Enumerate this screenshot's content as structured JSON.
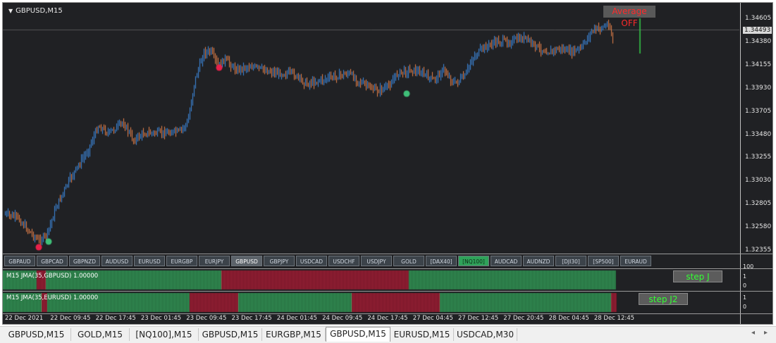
{
  "chart": {
    "symbol_title": "GBPUSD,M15",
    "average_box": "Average OFF",
    "current_price": "1.34493",
    "price_ticks": [
      "1.34605",
      "1.34380",
      "1.34155",
      "1.33930",
      "1.33705",
      "1.33480",
      "1.33255",
      "1.33030",
      "1.32805",
      "1.32580",
      "1.32355"
    ],
    "colors": {
      "bull": "#3d8be0",
      "bear": "#e8834a",
      "bg": "#202124",
      "dot_red": "#e8204a",
      "dot_green": "#3fbf78"
    }
  },
  "symbol_buttons": [
    {
      "label": "GBPAUD",
      "state": "normal"
    },
    {
      "label": "GBPCAD",
      "state": "normal"
    },
    {
      "label": "GBPNZD",
      "state": "normal"
    },
    {
      "label": "AUDUSD",
      "state": "normal"
    },
    {
      "label": "EURUSD",
      "state": "normal"
    },
    {
      "label": "EURGBP",
      "state": "normal"
    },
    {
      "label": "EURJPY",
      "state": "normal"
    },
    {
      "label": "GBPUSD",
      "state": "active"
    },
    {
      "label": "GBPJPY",
      "state": "normal"
    },
    {
      "label": "USDCAD",
      "state": "normal"
    },
    {
      "label": "USDCHF",
      "state": "normal"
    },
    {
      "label": "USDJPY",
      "state": "normal"
    },
    {
      "label": "GOLD",
      "state": "normal"
    },
    {
      "label": "[DAX40]",
      "state": "normal"
    },
    {
      "label": "[NQ100]",
      "state": "green"
    },
    {
      "label": "AUDCAD",
      "state": "normal"
    },
    {
      "label": "AUDNZD",
      "state": "normal"
    },
    {
      "label": "[DJI30]",
      "state": "normal"
    },
    {
      "label": "[SP500]",
      "state": "normal"
    },
    {
      "label": "EURAUD",
      "state": "normal"
    }
  ],
  "indicator1": {
    "label": "M15 JMA(35,GBPUSD) 1.00000",
    "step_button": "step J",
    "scale_top": "1",
    "scale_bottom": "0",
    "scale_header": "100",
    "segments": [
      {
        "color": "green",
        "from": 0.0,
        "to": 0.046
      },
      {
        "color": "red",
        "from": 0.046,
        "to": 0.059
      },
      {
        "color": "green",
        "from": 0.059,
        "to": 0.297
      },
      {
        "color": "red",
        "from": 0.297,
        "to": 0.552
      },
      {
        "color": "green",
        "from": 0.552,
        "to": 0.832
      }
    ]
  },
  "indicator2": {
    "label": "M15 JMA(35,EURUSD) 1.00000",
    "step_button": "step J2",
    "scale_top": "1",
    "scale_bottom": "0",
    "segments": [
      {
        "color": "green",
        "from": 0.0,
        "to": 0.053
      },
      {
        "color": "red",
        "from": 0.053,
        "to": 0.061
      },
      {
        "color": "green",
        "from": 0.061,
        "to": 0.254
      },
      {
        "color": "red",
        "from": 0.254,
        "to": 0.32
      },
      {
        "color": "green",
        "from": 0.32,
        "to": 0.474
      },
      {
        "color": "red",
        "from": 0.474,
        "to": 0.594
      },
      {
        "color": "green",
        "from": 0.594,
        "to": 0.826
      },
      {
        "color": "red",
        "from": 0.826,
        "to": 0.832
      }
    ]
  },
  "time_ticks": [
    "22 Dec 2021",
    "22 Dec 09:45",
    "22 Dec 17:45",
    "23 Dec 01:45",
    "23 Dec 09:45",
    "23 Dec 17:45",
    "24 Dec 01:45",
    "24 Dec 09:45",
    "24 Dec 17:45",
    "27 Dec 04:45",
    "27 Dec 12:45",
    "27 Dec 20:45",
    "28 Dec 04:45",
    "28 Dec 12:45"
  ],
  "tabs": [
    {
      "label": "GBPUSD,M15",
      "active": false
    },
    {
      "label": "GOLD,M15",
      "active": false
    },
    {
      "label": "[NQ100],M15",
      "active": false
    },
    {
      "label": "GBPUSD,M15",
      "active": false
    },
    {
      "label": "EURGBP,M15",
      "active": false
    },
    {
      "label": "GBPUSD,M15",
      "active": true
    },
    {
      "label": "EURUSD,M15",
      "active": false
    },
    {
      "label": "USDCAD,M30",
      "active": false
    }
  ],
  "tab_arrows": {
    "left": "◂",
    "right": "▸"
  }
}
